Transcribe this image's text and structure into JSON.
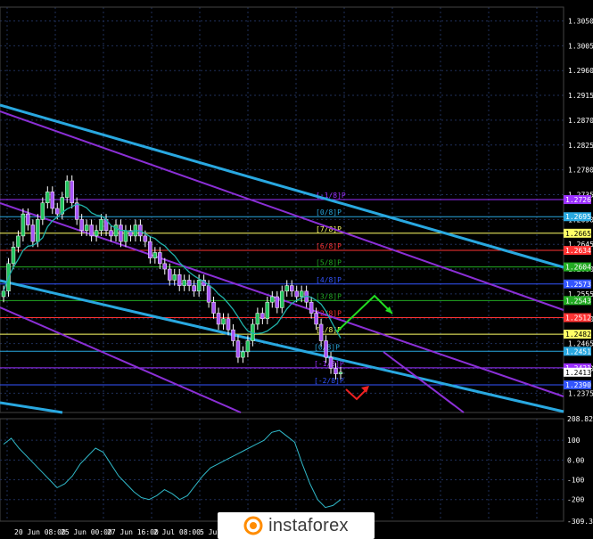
{
  "colors": {
    "background": "#000000",
    "grid": "#1f2f5a",
    "text": "#ffffff",
    "bull": "#22c55e",
    "bear": "#a855f7",
    "channel_cyan": "#29a8e0",
    "channel_purple": "#8b2fd6",
    "ma": "#20b2aa",
    "cci": "#30b8c8",
    "arrow_up": "#22dd22",
    "arrow_down": "#ee2222"
  },
  "watermark": {
    "text": "instaforex",
    "icon": "instaforex-logo-icon"
  },
  "chart_data": [
    {
      "type": "candlestick",
      "title": "",
      "ylim": [
        1.234,
        1.3075
      ],
      "x_labels": [
        "20 Jun 08:00",
        "25 Jun 00:00",
        "27 Jun 16:00",
        "2 Jul 08:00",
        "5 Jul 0"
      ],
      "y_ticks": [
        1.305,
        1.3005,
        1.296,
        1.2915,
        1.287,
        1.2825,
        1.278,
        1.2735,
        1.269,
        1.2645,
        1.26,
        1.2555,
        1.251,
        1.2465,
        1.242,
        1.2375
      ],
      "murrey_levels": [
        {
          "label": "[-1/8]P",
          "value": 1.2726,
          "color": "#9b30ff"
        },
        {
          "label": "[0/8]P",
          "value": 1.2695,
          "color": "#29a8e0"
        },
        {
          "label": "[7/8]P",
          "value": 1.2665,
          "color": "#ffff66"
        },
        {
          "label": "[6/8]P",
          "value": 1.2634,
          "color": "#ff3333"
        },
        {
          "label": "[5/8]P",
          "value": 1.2604,
          "color": "#22aa22"
        },
        {
          "label": "[4/8]P",
          "value": 1.2573,
          "color": "#3355ff"
        },
        {
          "label": "[3/8]P",
          "value": 1.2543,
          "color": "#22aa22"
        },
        {
          "label": "[2/8]P",
          "value": 1.2512,
          "color": "#ff3333"
        },
        {
          "label": "[1/8]P",
          "value": 1.2482,
          "color": "#ffff66"
        },
        {
          "label": "[0/8]P",
          "value": 1.2451,
          "color": "#29a8e0"
        },
        {
          "label": "[-1/8]P",
          "value": 1.2421,
          "color": "#9b30ff"
        },
        {
          "label": "[-2/8]P",
          "value": 1.239,
          "color": "#3355ff"
        }
      ],
      "price_tags": [
        "1.2726",
        "1.2695",
        "1.2665",
        "1.2634",
        "1.2604",
        "1.2573",
        "1.2543",
        "1.2512",
        "1.2482",
        "1.2451",
        "1.2421",
        "1.2413",
        "1.2390"
      ],
      "close_series": [
        1.256,
        1.261,
        1.264,
        1.266,
        1.27,
        1.268,
        1.265,
        1.269,
        1.272,
        1.274,
        1.271,
        1.27,
        1.273,
        1.276,
        1.272,
        1.269,
        1.267,
        1.268,
        1.266,
        1.267,
        1.269,
        1.267,
        1.266,
        1.268,
        1.265,
        1.267,
        1.266,
        1.268,
        1.266,
        1.265,
        1.262,
        1.263,
        1.261,
        1.26,
        1.258,
        1.259,
        1.257,
        1.258,
        1.257,
        1.256,
        1.258,
        1.257,
        1.254,
        1.252,
        1.25,
        1.251,
        1.249,
        1.247,
        1.244,
        1.245,
        1.247,
        1.25,
        1.252,
        1.251,
        1.254,
        1.255,
        1.253,
        1.256,
        1.257,
        1.256,
        1.255,
        1.256,
        1.254,
        1.252,
        1.25,
        1.247,
        1.244,
        1.242,
        1.241,
        1.2413
      ]
    },
    {
      "type": "line",
      "title": "",
      "indicator": "CCI",
      "ylim": [
        -309.322,
        208.8249
      ],
      "y_ticks": [
        "208.8249",
        "100",
        "0.00",
        "-100",
        "-200",
        "-309.3220"
      ],
      "values": [
        80,
        110,
        60,
        20,
        -20,
        -60,
        -100,
        -140,
        -120,
        -80,
        -20,
        20,
        60,
        40,
        -20,
        -80,
        -120,
        -160,
        -190,
        -200,
        -180,
        -150,
        -170,
        -200,
        -180,
        -130,
        -80,
        -40,
        -20,
        0,
        20,
        40,
        60,
        80,
        100,
        140,
        150,
        120,
        90,
        -20,
        -120,
        -200,
        -240,
        -230,
        -200
      ]
    }
  ]
}
